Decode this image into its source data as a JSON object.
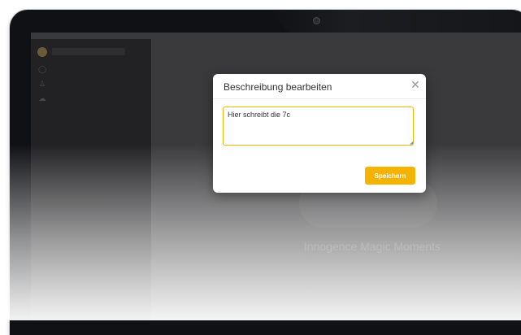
{
  "dialog": {
    "title": "Beschreibung bearbeiten",
    "close_icon": "close-icon",
    "description_value": "Hier schreibt die 7c",
    "save_label": "Speichern"
  },
  "background": {
    "caption": "Innogence Magic Moments"
  },
  "colors": {
    "accent": "#f5b301",
    "screen": "#3a3a3c",
    "sidebar": "#222224"
  }
}
